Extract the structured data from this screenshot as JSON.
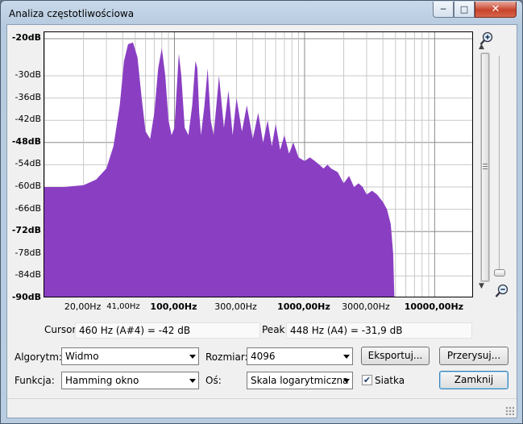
{
  "window": {
    "title": "Analiza częstotliwościowa",
    "controls": {
      "minimize": "─",
      "maximize": "□",
      "close": "✕"
    }
  },
  "y_axis": {
    "ticks": [
      {
        "label": "-20dB",
        "bold": true
      },
      {
        "label": "-30dB",
        "bold": false
      },
      {
        "label": "-36dB",
        "bold": false
      },
      {
        "label": "-42dB",
        "bold": false
      },
      {
        "label": "-48dB",
        "bold": true
      },
      {
        "label": "-54dB",
        "bold": false
      },
      {
        "label": "-60dB",
        "bold": false
      },
      {
        "label": "-66dB",
        "bold": false
      },
      {
        "label": "-72dB",
        "bold": true
      },
      {
        "label": "-78dB",
        "bold": false
      },
      {
        "label": "-84dB",
        "bold": false
      },
      {
        "label": "-90dB",
        "bold": true
      }
    ]
  },
  "x_axis": {
    "ticks": [
      {
        "label": "20,00Hz",
        "hz": 20,
        "style": "normal"
      },
      {
        "label": "41,00Hz",
        "hz": 41,
        "style": "small"
      },
      {
        "label": "100,00Hz",
        "hz": 100,
        "style": "bold"
      },
      {
        "label": "300,00Hz",
        "hz": 300,
        "style": "normal"
      },
      {
        "label": "1000,00Hz",
        "hz": 1000,
        "style": "bold"
      },
      {
        "label": "3000,00Hz",
        "hz": 3000,
        "style": "normal"
      },
      {
        "label": "10000,00Hz",
        "hz": 10000,
        "style": "bold"
      }
    ]
  },
  "chart_data": {
    "type": "area",
    "scale": "log",
    "grid": true,
    "x_range_hz": [
      10,
      20000
    ],
    "y_range_db": [
      -90,
      -20
    ],
    "fill_color": "#8a3fc3",
    "series": [
      {
        "x": [
          10,
          14,
          20,
          25,
          30,
          34,
          38,
          41,
          44,
          48,
          52,
          56,
          60,
          65,
          70,
          75,
          80,
          85,
          90,
          95,
          100,
          104,
          108,
          113,
          120,
          128,
          137,
          145,
          150,
          155,
          160,
          170,
          180,
          190,
          200,
          210,
          220,
          240,
          260,
          280,
          300,
          330,
          360,
          400,
          440,
          480,
          520,
          560,
          600,
          650,
          700,
          760,
          820,
          900,
          1000,
          1100,
          1200,
          1300,
          1400,
          1500,
          1600,
          1800,
          2000,
          2200,
          2400,
          2600,
          2800,
          3000,
          3300,
          3600,
          4000,
          4300,
          4600,
          4800,
          4900
        ],
        "y": [
          -60,
          -60,
          -59.5,
          -58,
          -55,
          -49,
          -38,
          -26,
          -21.5,
          -21,
          -25,
          -36,
          -45,
          -47,
          -40,
          -28,
          -22.5,
          -30,
          -42,
          -46,
          -44,
          -34,
          -24,
          -30,
          -44,
          -46,
          -38,
          -26,
          -28,
          -40,
          -46,
          -38,
          -28,
          -42,
          -46,
          -38,
          -30,
          -44,
          -34,
          -46,
          -36,
          -45,
          -38,
          -47,
          -40,
          -48,
          -42,
          -49,
          -43,
          -50,
          -46,
          -51,
          -48,
          -52,
          -53,
          -52,
          -53,
          -54,
          -55,
          -54,
          -55,
          -56,
          -59,
          -57,
          -60,
          -59,
          -60,
          -62,
          -61,
          -62,
          -64,
          -66,
          -70,
          -78,
          -90
        ]
      }
    ]
  },
  "zoom": {
    "in_icon": "zoom-in-icon",
    "out_icon": "zoom-out-icon"
  },
  "info": {
    "cursor_label": "Cursor:",
    "cursor_value": "460 Hz (A#4) = -42 dB",
    "peak_label": "Peak:",
    "peak_value": "448 Hz (A4) = -31,9 dB"
  },
  "controls": {
    "algorithm_label": "Algorytm:",
    "algorithm_value": "Widmo",
    "size_label": "Rozmiar:",
    "size_value": "4096",
    "export_button": "Eksportuj...",
    "replot_button": "Przerysuj...",
    "function_label": "Funkcja:",
    "function_value": "Hamming okno",
    "axis_label": "Oś:",
    "axis_value": "Skala logarytmiczna",
    "grid_label": "Siatka",
    "grid_checked": "✔",
    "close_button": "Zamknij"
  }
}
